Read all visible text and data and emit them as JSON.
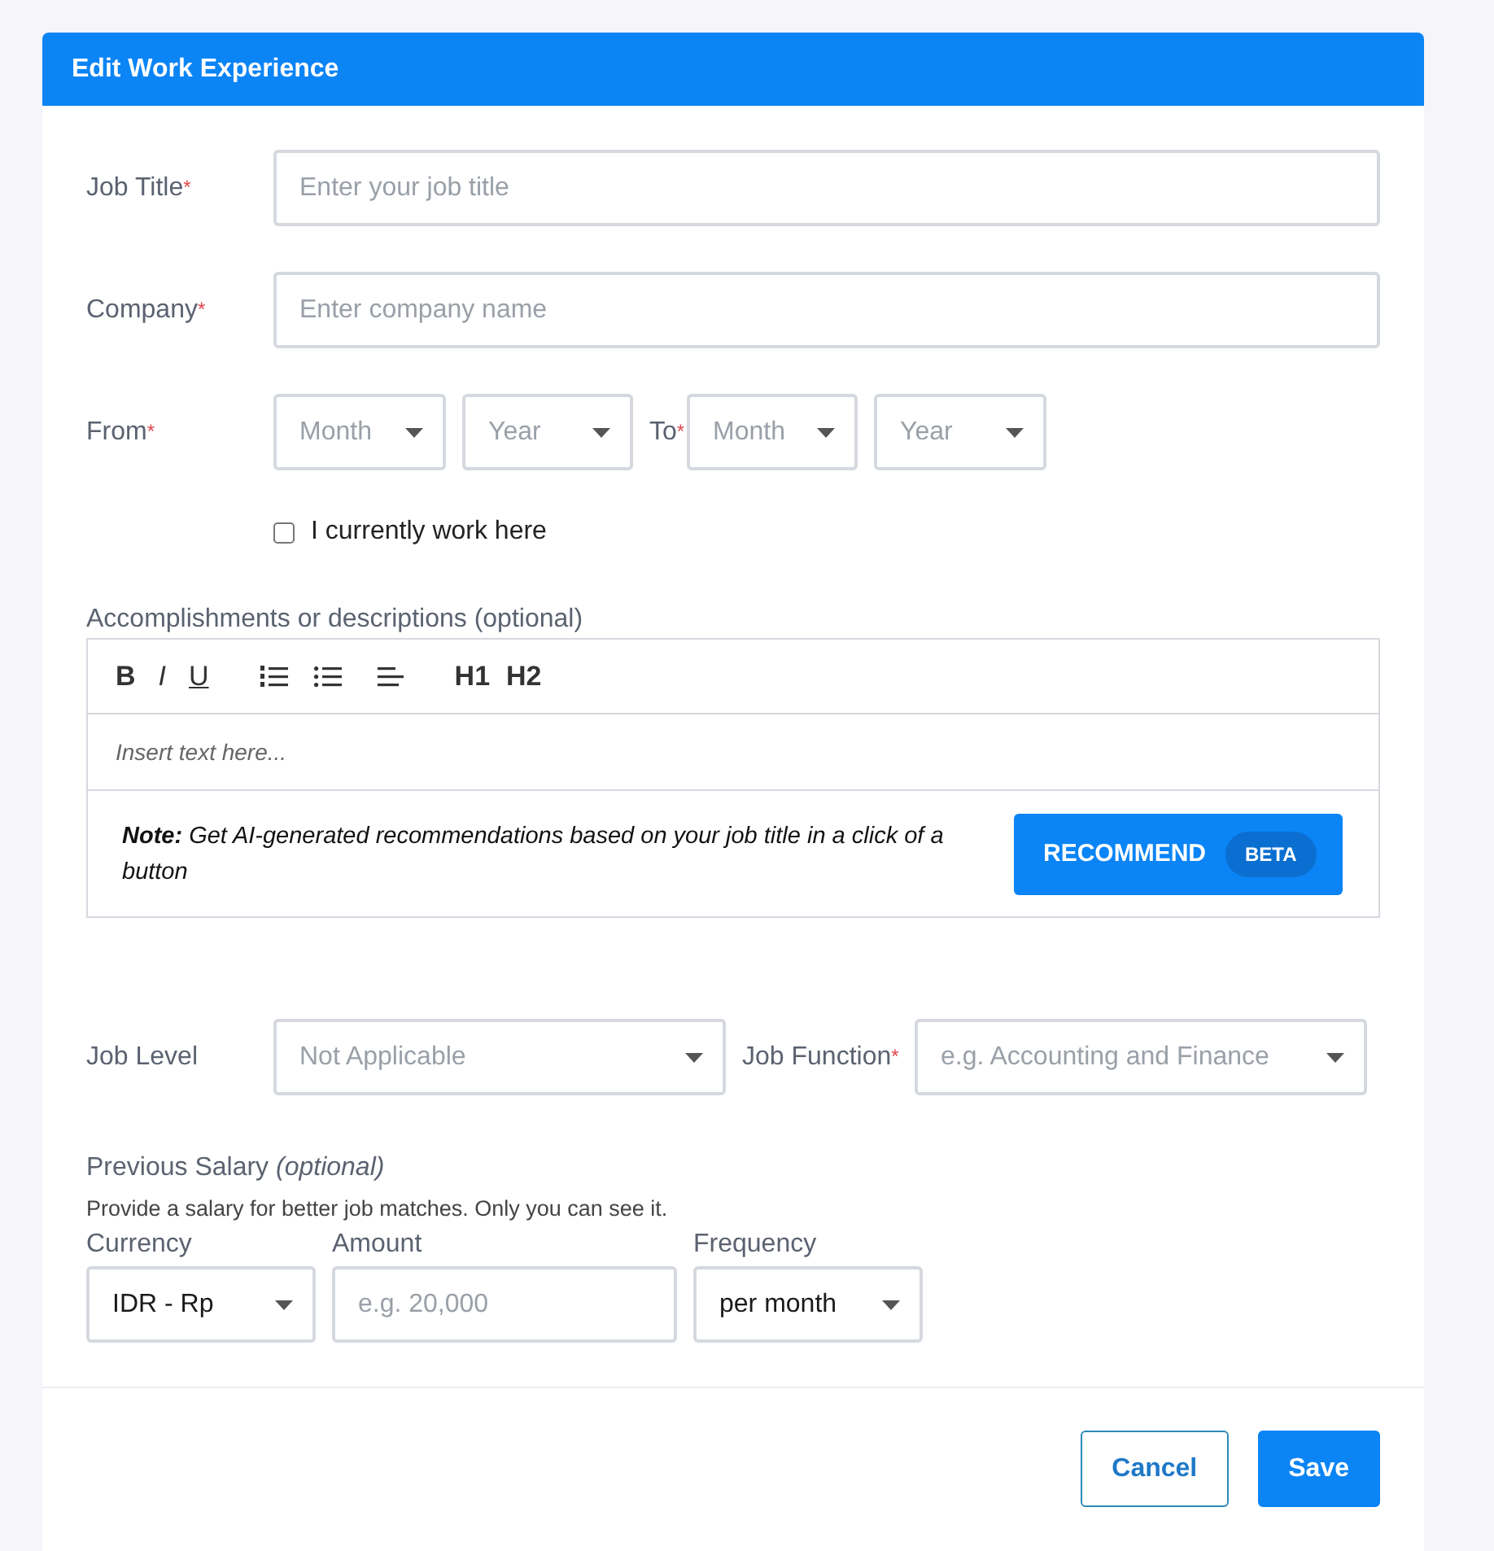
{
  "dialog": {
    "title": "Edit Work Experience"
  },
  "job_title": {
    "label": "Job Title",
    "mark": "*",
    "placeholder": "Enter your job title"
  },
  "company": {
    "label": "Company",
    "mark": "*",
    "placeholder": "Enter company name"
  },
  "dates": {
    "from_label": "From",
    "from_mark": "*",
    "from_month": {
      "placeholder": "Month"
    },
    "from_year": {
      "placeholder": "Year"
    },
    "to_label": "To",
    "to_mark": "*",
    "to_month": {
      "placeholder": "Month"
    },
    "to_year": {
      "placeholder": "Year"
    }
  },
  "current_job": {
    "label": "I currently work here",
    "checked": false
  },
  "description": {
    "label": "Accomplishments or descriptions (optional)",
    "toolbar": [
      {
        "kind": "bold",
        "label": "B"
      },
      {
        "kind": "italic",
        "label": "I"
      },
      {
        "kind": "underline",
        "label": "U"
      },
      {
        "kind": "ordered-list"
      },
      {
        "kind": "bullet-list"
      },
      {
        "kind": "align-left"
      },
      {
        "kind": "heading",
        "label": "H1"
      },
      {
        "kind": "heading",
        "label": "H2"
      }
    ],
    "placeholder": "Insert text here...",
    "note": "**Note:** Get AI-generated recommendations based on your job title in a click of a button",
    "recommend_button": {
      "label": "RECOMMEND",
      "badge": "BETA"
    }
  },
  "job_level": {
    "label": "Job Level",
    "placeholder": "Not Applicable"
  },
  "job_function": {
    "label": "Job Function",
    "mark": "*",
    "placeholder": "e.g. Accounting and Finance"
  },
  "salary": {
    "title": "Previous Salary",
    "title_note": "(optional)",
    "hint": "Provide a salary for better job matches. Only you can see it.",
    "currency": {
      "label": "Currency",
      "value": "IDR - Rp"
    },
    "amount": {
      "label": "Amount",
      "placeholder": "e.g. 20,000"
    },
    "frequency": {
      "label": "Frequency",
      "value": "per month"
    }
  },
  "buttons": {
    "cancel": "Cancel",
    "save": "Save"
  }
}
